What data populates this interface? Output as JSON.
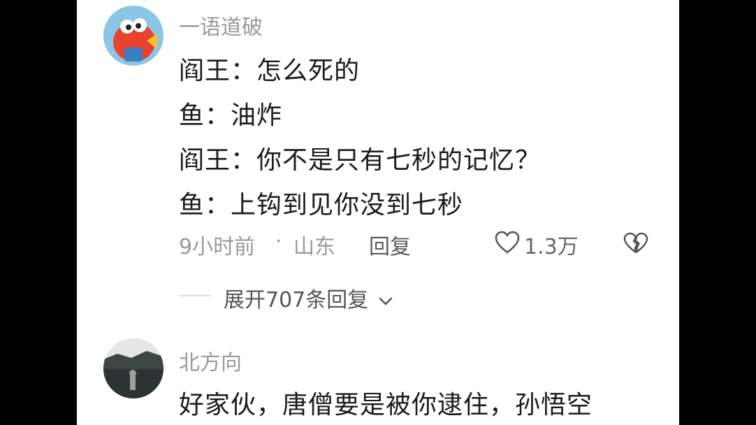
{
  "comments": [
    {
      "username": "一语道破",
      "lines": [
        "阎王：怎么死的",
        "鱼：油炸",
        "阎王：你不是只有七秒的记忆？",
        "鱼：上钩到见你没到七秒"
      ],
      "time": "9小时前",
      "separator": "·",
      "location": "山东",
      "reply_label": "回复",
      "like_count": "1.3万",
      "expand_label": "展开707条回复"
    },
    {
      "username": "北方向",
      "lines": [
        "好家伙，唐僧要是被你逮住，孙悟空"
      ]
    }
  ],
  "icons": {
    "like": "heart-outline-icon",
    "dislike": "broken-heart-icon",
    "expand": "chevron-down-icon"
  },
  "colors": {
    "background": "#ffffff",
    "text": "#1b1b1b",
    "muted": "#9a9a9a",
    "letterbox": "#000000"
  }
}
